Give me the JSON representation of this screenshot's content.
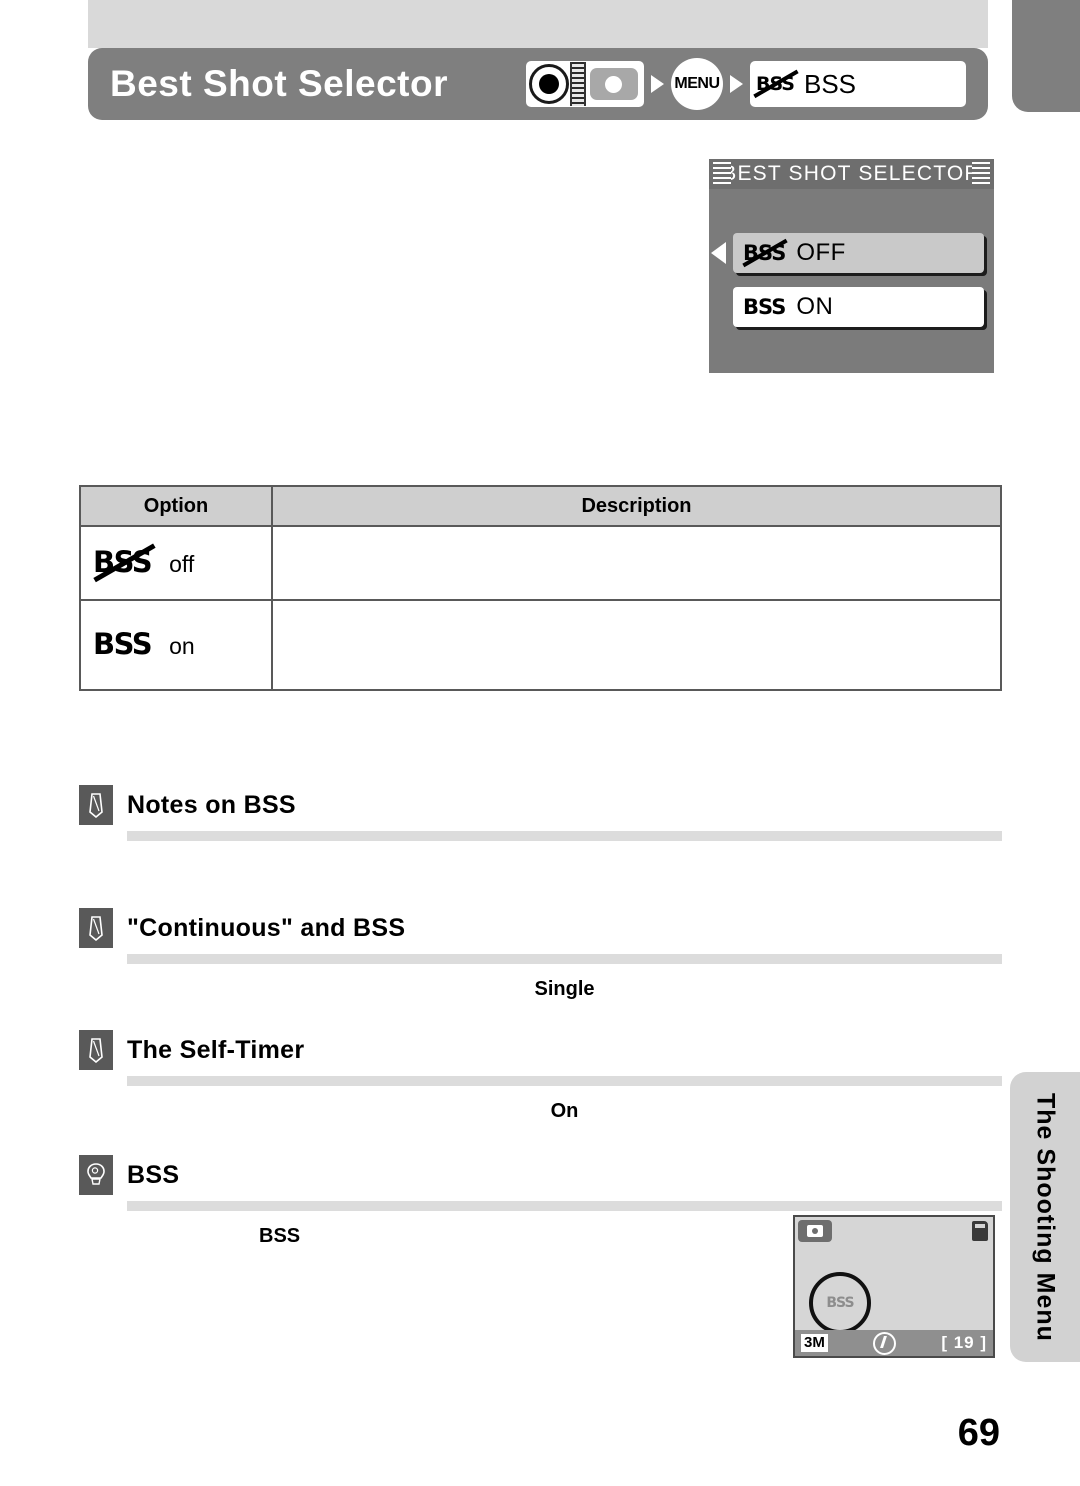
{
  "header": {
    "title": "Best Shot Selector",
    "breadcrumb": {
      "mode_dial_icon": "mode-dial-shooting-icon",
      "menu_label": "MENU",
      "item_icon": "bss-off-icon",
      "item_label": "BSS"
    }
  },
  "lcd_menu": {
    "title": "BEST SHOT SELECTOR",
    "items": [
      {
        "icon": "bss-off-icon",
        "label": "OFF",
        "tag": "BSS",
        "selected": true
      },
      {
        "icon": "bss-on-icon",
        "label": "ON",
        "tag": "BSS",
        "selected": false
      }
    ]
  },
  "options_table": {
    "columns": [
      "Option",
      "Description"
    ],
    "rows": [
      {
        "tag": "BSS",
        "icon": "bss-off-icon",
        "label": "off",
        "description": ""
      },
      {
        "tag": "BSS",
        "icon": "bss-on-icon",
        "label": "on",
        "description": ""
      }
    ]
  },
  "notes": [
    {
      "icon": "pencil-note-icon",
      "title": "Notes on BSS",
      "body": ""
    },
    {
      "icon": "pencil-note-icon",
      "title": "\"Continuous\" and BSS",
      "body": "Single"
    },
    {
      "icon": "pencil-note-icon",
      "title": "The Self-Timer",
      "body": "On"
    },
    {
      "icon": "lightbulb-tip-icon",
      "title": "BSS",
      "body": "BSS"
    }
  ],
  "side_tab": {
    "label": "The Shooting Menu"
  },
  "monitor": {
    "mode_icon": "camera-mode-icon",
    "card_icon": "memory-card-icon",
    "indicator": "BSS",
    "image_size": "3M",
    "flash_icon": "flash-off-icon",
    "frames_remaining": "[ 19 ]"
  },
  "page_number": "69",
  "colors": {
    "header_bar": "#7f7f7f",
    "top_band": "#d9d9d9",
    "rule": "#dcdcdc",
    "table_header": "#cfcfcf",
    "side_tab": "#d2d2d2",
    "icon_box": "#595959"
  }
}
